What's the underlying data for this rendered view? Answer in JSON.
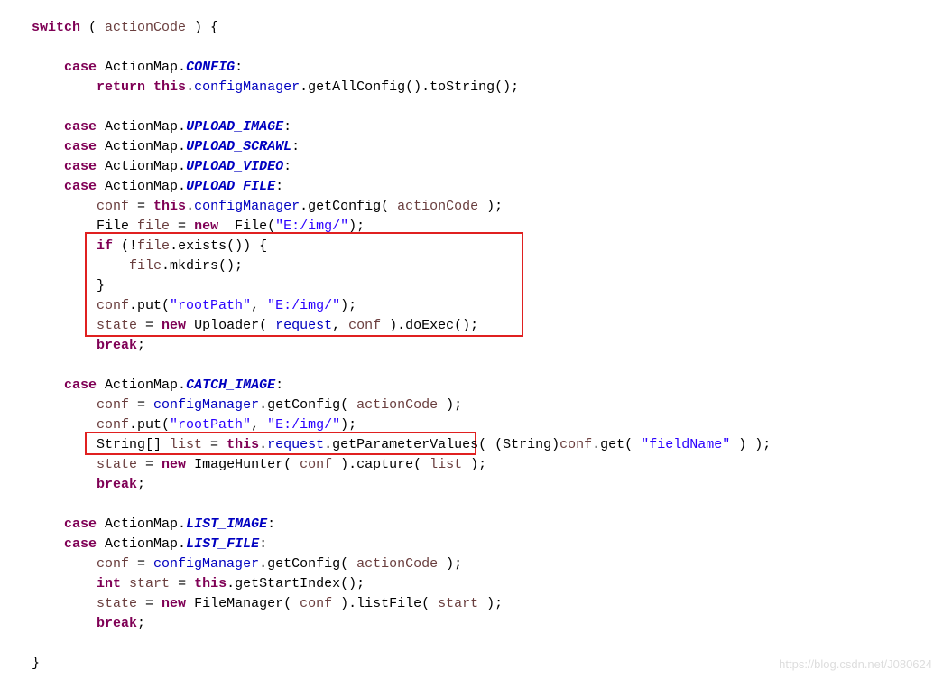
{
  "code": {
    "switch": "switch",
    "actionCode": "actionCode",
    "lbrace": "{",
    "rbrace": "}",
    "case": "case",
    "actionMap": "ActionMap",
    "dot": ".",
    "colon": ":",
    "semi": ";",
    "comma": ",",
    "configLabel": "CONFIG",
    "returnKw": "return",
    "thisKw": "this",
    "configManager": "configManager",
    "getAllConfig": "getAllConfig",
    "toString": "toString",
    "lp": "(",
    "rp": ")",
    "uploadImage": "UPLOAD_IMAGE",
    "uploadScrawl": "UPLOAD_SCRAWL",
    "uploadVideo": "UPLOAD_VIDEO",
    "uploadFile": "UPLOAD_FILE",
    "conf": "conf",
    "eq": "=",
    "getConfig": "getConfig",
    "FileType": "File",
    "fileVar": "file",
    "newKw": "new",
    "strImg": "\"E:/img/\"",
    "ifKw": "if",
    "not": "!",
    "exists": "exists",
    "mkdirs": "mkdirs",
    "put": "put",
    "rootPath": "\"rootPath\"",
    "state": "state",
    "Uploader": "Uploader",
    "request": "request",
    "doExec": "doExec",
    "breakKw": "break",
    "catchImage": "CATCH_IMAGE",
    "StringArr": "String[]",
    "list": "list",
    "getParameterValues": "getParameterValues",
    "StringCast": "(String)",
    "get": "get",
    "fieldName": "\"fieldName\"",
    "ImageHunter": "ImageHunter",
    "capture": "capture",
    "listImage": "LIST_IMAGE",
    "listFile": "LIST_FILE",
    "intKw": "int",
    "start": "start",
    "getStartIndex": "getStartIndex",
    "FileManager": "FileManager",
    "listFileMethod": "listFile"
  },
  "watermark": "https://blog.csdn.net/J080624"
}
